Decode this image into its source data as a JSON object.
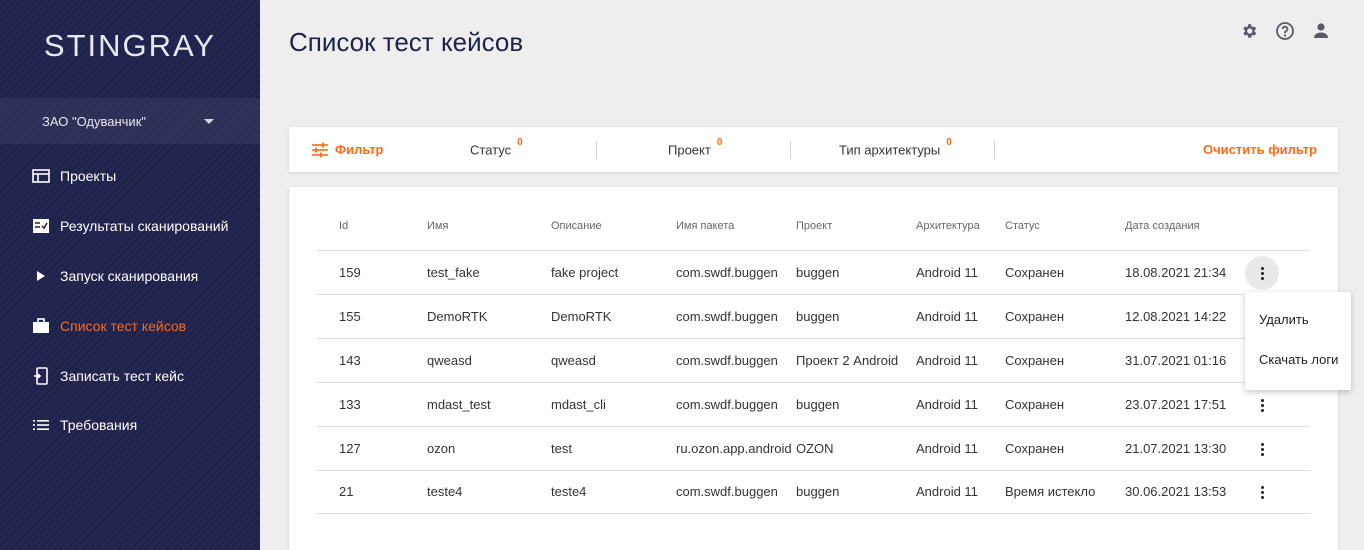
{
  "sidebar": {
    "logo": "STINGRAY",
    "company": "ЗАО \"Одуванчик\"",
    "items": [
      {
        "label": "Проекты",
        "icon": "projects-icon"
      },
      {
        "label": "Результаты сканирований",
        "icon": "scan-results-icon"
      },
      {
        "label": "Запуск сканирования",
        "icon": "play-icon"
      },
      {
        "label": "Список тест кейсов",
        "icon": "briefcase-icon",
        "active": true
      },
      {
        "label": "Записать тест кейс",
        "icon": "record-icon"
      },
      {
        "label": "Требования",
        "icon": "list-icon"
      }
    ]
  },
  "header": {
    "title": "Список тест кейсов",
    "icons": [
      "gear-icon",
      "help-icon",
      "user-icon"
    ]
  },
  "filter": {
    "filter_label": "Фильтр",
    "status_label": "Статус",
    "status_count": "0",
    "project_label": "Проект",
    "project_count": "0",
    "arch_label": "Тип архитектуры",
    "arch_count": "0",
    "clear_label": "Очистить фильтр"
  },
  "table": {
    "columns": [
      "Id",
      "Имя",
      "Описание",
      "Имя пакета",
      "Проект",
      "Архитектура",
      "Статус",
      "Дата создания"
    ],
    "rows": [
      [
        "159",
        "test_fake",
        "fake project",
        "com.swdf.buggen",
        "buggen",
        "Android 11",
        "Сохранен",
        "18.08.2021 21:34"
      ],
      [
        "155",
        "DemoRTK",
        "DemoRTK",
        "com.swdf.buggen",
        "buggen",
        "Android 11",
        "Сохранен",
        "12.08.2021 14:22"
      ],
      [
        "143",
        "qweasd",
        "qweasd",
        "com.swdf.buggen",
        "Проект 2 Android",
        "Android 11",
        "Сохранен",
        "31.07.2021 01:16"
      ],
      [
        "133",
        "mdast_test",
        "mdast_cli",
        "com.swdf.buggen",
        "buggen",
        "Android 11",
        "Сохранен",
        "23.07.2021 17:51"
      ],
      [
        "127",
        "ozon",
        "test",
        "ru.ozon.app.android",
        "OZON",
        "Android 11",
        "Сохранен",
        "21.07.2021 13:30"
      ],
      [
        "21",
        "teste4",
        "teste4",
        "com.swdf.buggen",
        "buggen",
        "Android 11",
        "Время истекло",
        "30.06.2021 13:53"
      ]
    ]
  },
  "row_menu": {
    "items": [
      "Удалить",
      "Скачать логи"
    ]
  },
  "colors": {
    "accent": "#ff6a1a",
    "sidebar_bg": "#1f2248",
    "title": "#1f2248"
  }
}
